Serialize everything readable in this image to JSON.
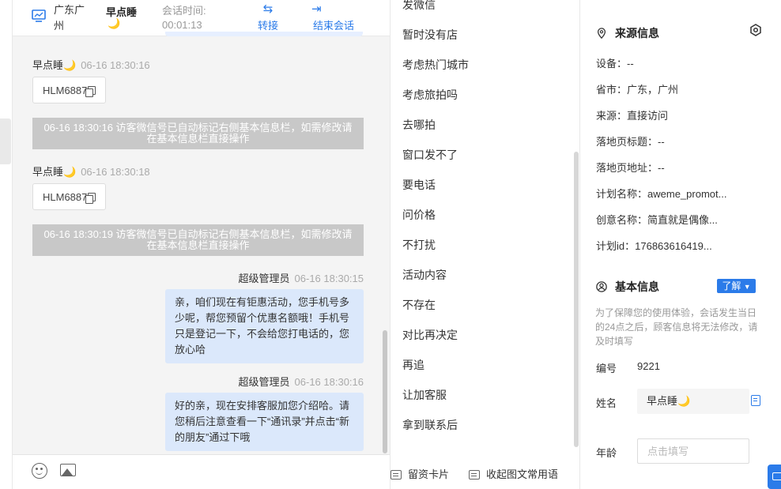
{
  "header": {
    "location": "广东广州",
    "visitor_name": "早点睡",
    "name_emoji": "🌙",
    "session_time_label": "会话时间:",
    "session_time": "00:01:13",
    "transfer": "转接",
    "end_session": "结束会话"
  },
  "messages": [
    {
      "sender": "早点睡🌙",
      "time": "06-16 18:30:16",
      "text": "HLM6887"
    },
    {
      "system": "06-16 18:30:16 访客微信号已自动标记右侧基本信息栏，如需修改请在基本信息栏直接操作"
    },
    {
      "sender": "早点睡🌙",
      "time": "06-16 18:30:18",
      "text": "HLM6887"
    },
    {
      "system": "06-16 18:30:19 访客微信号已自动标记右侧基本信息栏，如需修改请在基本信息栏直接操作"
    },
    {
      "sender": "超级管理员",
      "time": "06-16 18:30:15",
      "text": "亲，咱们现在有钜惠活动，您手机号多少呢，帮您预留个优惠名额哦！手机号只是登记一下，不会给您打电话的，您放心哈"
    },
    {
      "sender": "超级管理员",
      "time": "06-16 18:30:16",
      "text": "好的亲，现在安排客服加您介绍哈。请您稍后注意查看一下“通讯录”并点击“新的朋友”通过下哦"
    }
  ],
  "quick_replies": [
    "发微信",
    "暂时没有店",
    "考虑热门城市",
    "考虑旅拍吗",
    "去哪拍",
    "窗口发不了",
    "要电话",
    "问价格",
    "不打扰",
    "活动内容",
    "不存在",
    "对比再决定",
    "再追",
    "让加客服",
    "拿到联系后"
  ],
  "quick_footer": {
    "card": "留资卡片",
    "collect": "收起图文常用语"
  },
  "source_info": {
    "title": "来源信息",
    "rows": [
      {
        "label": "设备：",
        "value": "--"
      },
      {
        "label": "省市：",
        "value": "广东，广州"
      },
      {
        "label": "来源：",
        "value": "直接访问"
      },
      {
        "label": "落地页标题：",
        "value": "--"
      },
      {
        "label": "落地页地址：",
        "value": "--"
      },
      {
        "label": "计划名称：",
        "value": "aweme_promot..."
      },
      {
        "label": "创意名称：",
        "value": "简直就是偶像..."
      },
      {
        "label": "计划id：",
        "value": "176863616419..."
      }
    ]
  },
  "basic_info": {
    "title": "基本信息",
    "learn_more": "了解",
    "notice": "为了保障您的使用体验，会话发生当日的24点之后，顾客信息将无法修改，请及时填写",
    "id_label": "编号",
    "id_value": "9221",
    "name_label": "姓名",
    "name_value": "早点睡🌙",
    "age_label": "年龄",
    "age_placeholder": "点击填写"
  },
  "colors": {
    "accent": "#2b7be9",
    "bubble_blue": "#dbe8fb",
    "system_note": "#c8c8c8"
  }
}
